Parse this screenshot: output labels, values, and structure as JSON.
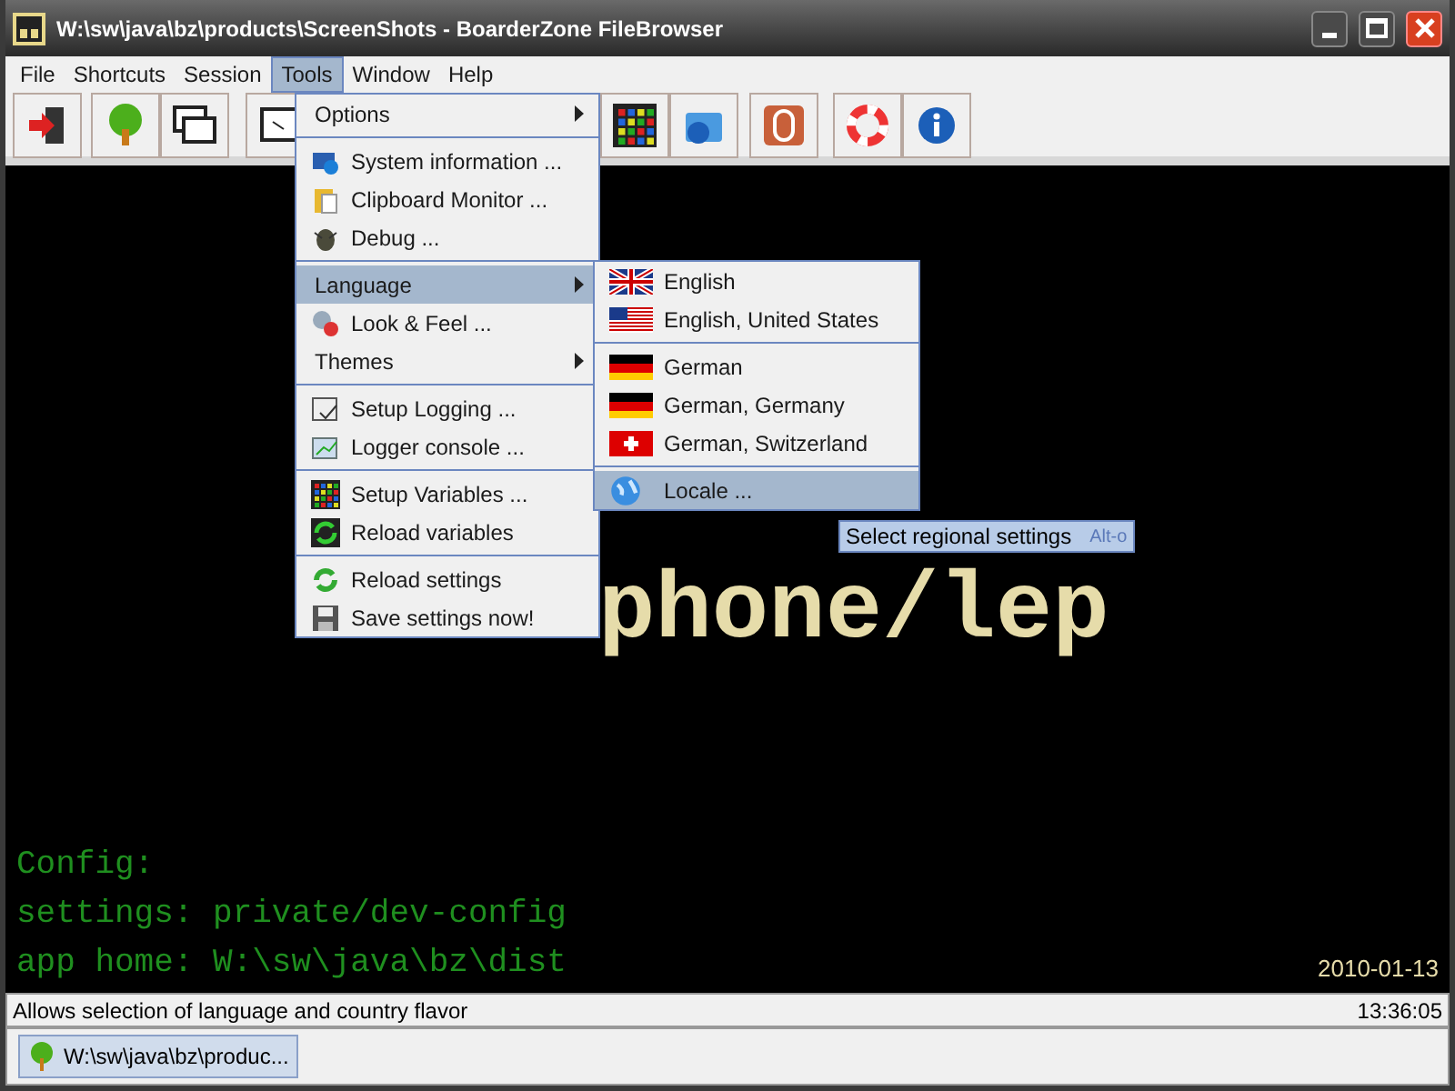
{
  "window": {
    "title": "W:\\sw\\java\\bz\\products\\ScreenShots - BoarderZone FileBrowser"
  },
  "menubar": [
    {
      "label": "File",
      "selected": false
    },
    {
      "label": "Shortcuts",
      "selected": false
    },
    {
      "label": "Session",
      "selected": false
    },
    {
      "label": "Tools",
      "selected": true
    },
    {
      "label": "Window",
      "selected": false
    },
    {
      "label": "Help",
      "selected": false
    }
  ],
  "tools_menu": {
    "items": [
      {
        "kind": "submenu",
        "label": "Options",
        "selected": false
      },
      {
        "kind": "separator"
      },
      {
        "kind": "item",
        "label": "System information ...",
        "selected": false
      },
      {
        "kind": "item",
        "label": "Clipboard Monitor ...",
        "selected": false
      },
      {
        "kind": "item",
        "label": "Debug ...",
        "selected": false
      },
      {
        "kind": "separator"
      },
      {
        "kind": "submenu",
        "label": "Language",
        "selected": true
      },
      {
        "kind": "item",
        "label": "Look & Feel ...",
        "selected": false
      },
      {
        "kind": "submenu",
        "label": "Themes",
        "selected": false
      },
      {
        "kind": "separator"
      },
      {
        "kind": "item",
        "label": "Setup Logging ...",
        "selected": false
      },
      {
        "kind": "item",
        "label": "Logger console ...",
        "selected": false
      },
      {
        "kind": "separator"
      },
      {
        "kind": "item",
        "label": "Setup Variables ...",
        "selected": false
      },
      {
        "kind": "item",
        "label": "Reload variables",
        "selected": false
      },
      {
        "kind": "separator"
      },
      {
        "kind": "item",
        "label": "Reload settings",
        "selected": false
      },
      {
        "kind": "item",
        "label": "Save settings now!",
        "selected": false
      }
    ]
  },
  "language_menu": {
    "items": [
      {
        "kind": "item",
        "label": "English",
        "selected": false
      },
      {
        "kind": "item",
        "label": "English, United States",
        "selected": false
      },
      {
        "kind": "separator"
      },
      {
        "kind": "item",
        "label": "German",
        "selected": false
      },
      {
        "kind": "item",
        "label": "German, Germany",
        "selected": false
      },
      {
        "kind": "item",
        "label": "German, Switzerland",
        "selected": false
      },
      {
        "kind": "separator"
      },
      {
        "kind": "item",
        "label": "Locale ...",
        "selected": true
      }
    ]
  },
  "tooltip": {
    "text": "Select regional settings",
    "shortcut": "Alt-o"
  },
  "console": {
    "banner": "phone/lep",
    "lines": [
      "Config:",
      "settings: private/dev-config",
      "app home: W:\\sw\\java\\bz\\dist"
    ],
    "date": "2010-01-13"
  },
  "status_bar": {
    "message": "Allows selection of language and country flavor",
    "time": "13:36:05"
  },
  "taskbar": [
    {
      "label": "W:\\sw\\java\\bz\\produc...",
      "selected": true
    }
  ]
}
